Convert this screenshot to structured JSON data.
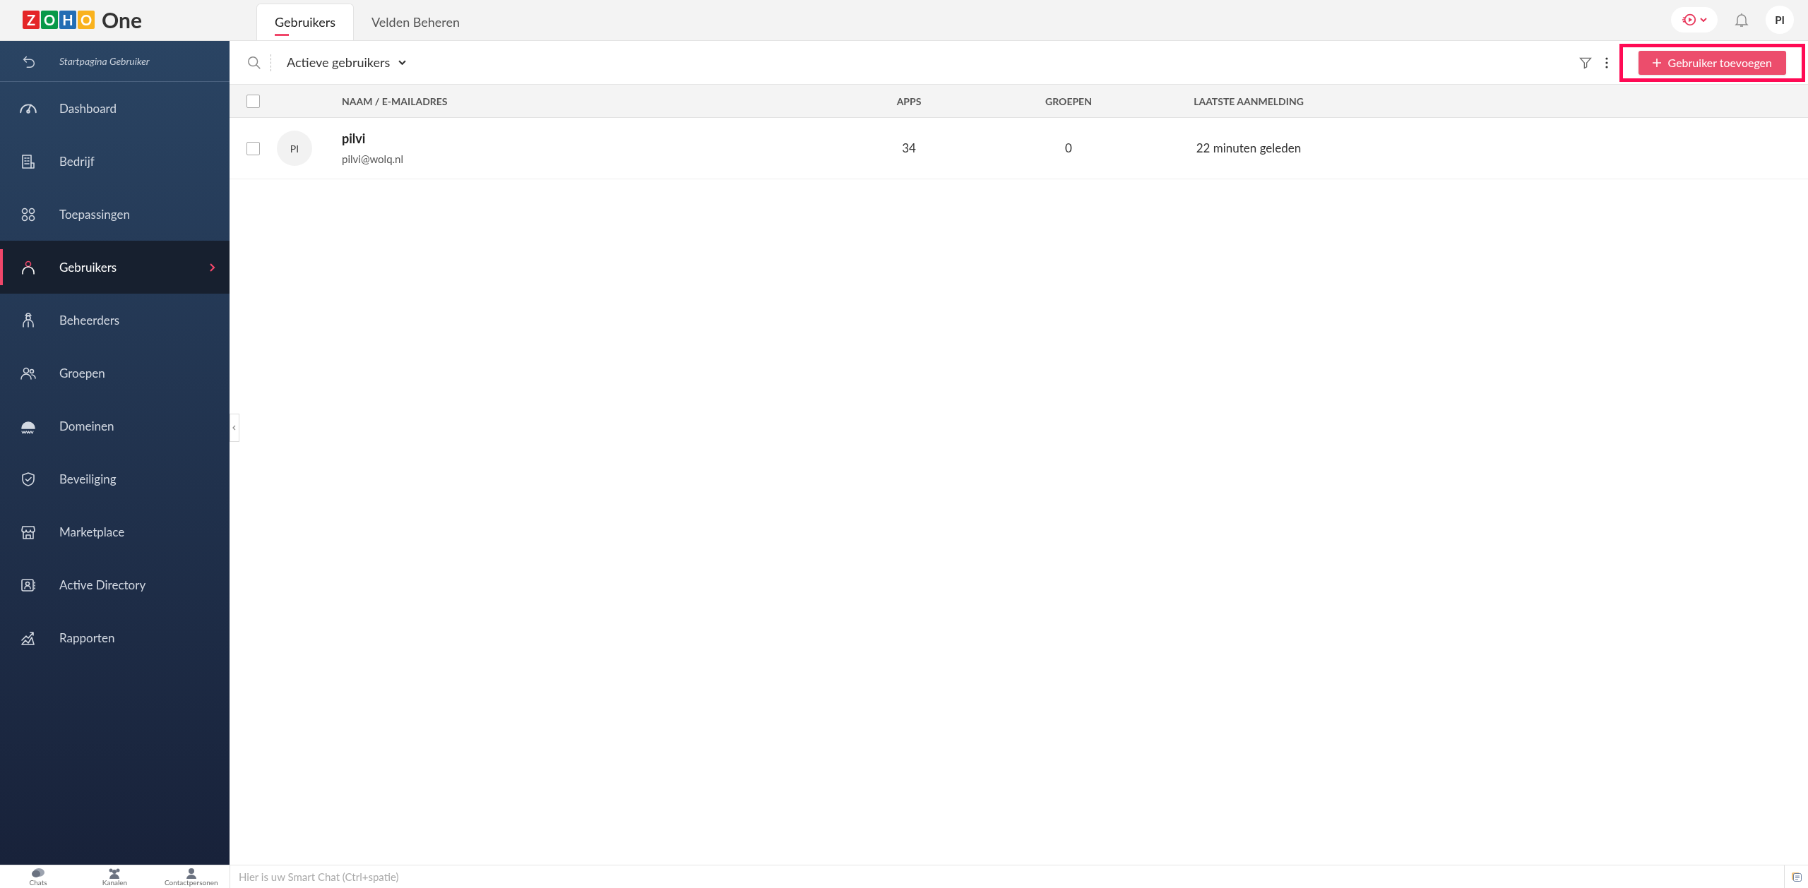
{
  "logo": {
    "letters": [
      {
        "char": "Z",
        "color": "#e42527"
      },
      {
        "char": "O",
        "color": "#089949"
      },
      {
        "char": "H",
        "color": "#226db4"
      },
      {
        "char": "O",
        "color": "#f9b21d"
      }
    ],
    "product": "One"
  },
  "tabs": [
    {
      "label": "Gebruikers",
      "selected": true
    },
    {
      "label": "Velden Beheren",
      "selected": false
    }
  ],
  "header": {
    "avatar": "PI"
  },
  "sidebar": {
    "back": "Startpagina Gebruiker",
    "items": [
      {
        "label": "Dashboard",
        "kind": "gauge",
        "selected": false
      },
      {
        "label": "Bedrijf",
        "kind": "building",
        "selected": false
      },
      {
        "label": "Toepassingen",
        "kind": "apps",
        "selected": false
      },
      {
        "label": "Gebruikers",
        "kind": "user",
        "selected": true
      },
      {
        "label": "Beheerders",
        "kind": "admin",
        "selected": false
      },
      {
        "label": "Groepen",
        "kind": "group",
        "selected": false
      },
      {
        "label": "Domeinen",
        "kind": "www",
        "selected": false
      },
      {
        "label": "Beveiliging",
        "kind": "shield",
        "selected": false
      },
      {
        "label": "Marketplace",
        "kind": "store",
        "selected": false
      },
      {
        "label": "Active Directory",
        "kind": "directory",
        "selected": false
      },
      {
        "label": "Rapporten",
        "kind": "report",
        "selected": false
      }
    ]
  },
  "toolbar": {
    "filter": "Actieve gebruikers",
    "add_button": "Gebruiker toevoegen",
    "highlighted": true
  },
  "table": {
    "select_all_checked": false,
    "columns": [
      "NAAM / E-MAILADRES",
      "APPS",
      "GROEPEN",
      "LAATSTE AANMELDING"
    ],
    "rows": [
      {
        "checked": false,
        "initials": "PI",
        "name": "pilvi",
        "email": "pilvi@wolq.nl",
        "apps": "34",
        "groups": "0",
        "last_login": "22 minuten geleden"
      }
    ]
  },
  "bottom_bar": {
    "tabs": [
      {
        "label": "Chats",
        "kind": "chat"
      },
      {
        "label": "Kanalen",
        "kind": "channels"
      },
      {
        "label": "Contactpersonen",
        "kind": "contact"
      }
    ],
    "chat_placeholder": "Hier is uw Smart Chat (Ctrl+spatie)"
  }
}
